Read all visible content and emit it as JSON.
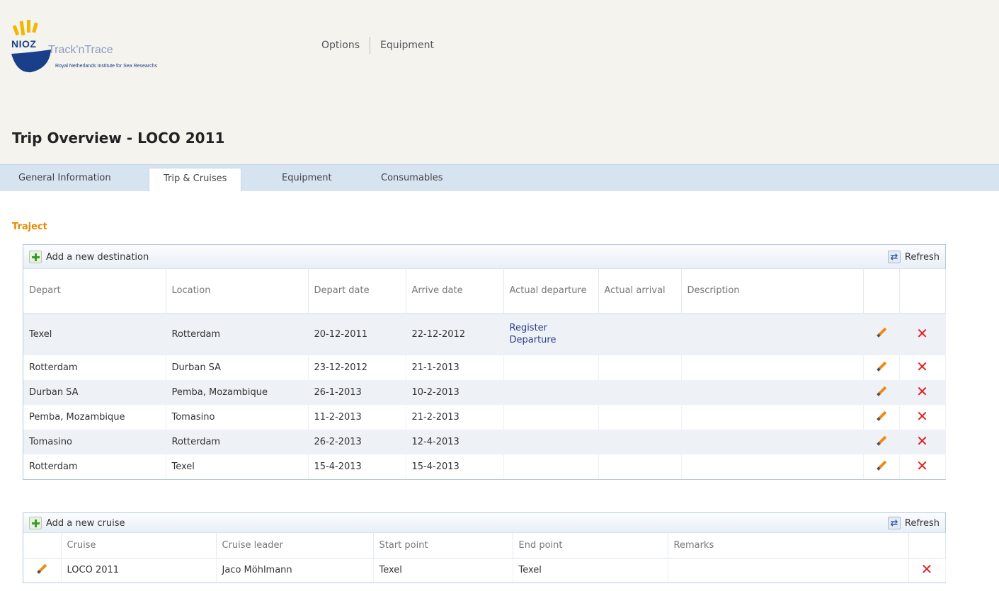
{
  "logo": {
    "brand": "NIOZ",
    "app_name": "Track'nTrace",
    "subtitle": "Royal Netherlands Institute for Sea Researchs"
  },
  "topnav": {
    "items": [
      "Options",
      "Equipment"
    ]
  },
  "page": {
    "title": "Trip Overview - LOCO 2011"
  },
  "tabs": [
    {
      "label": "General Information",
      "active": false
    },
    {
      "label": "Trip & Cruises",
      "active": true
    },
    {
      "label": "Equipment",
      "active": false
    },
    {
      "label": "Consumables",
      "active": false
    }
  ],
  "traject": {
    "section_title": "Traject",
    "add_label": "Add a new destination",
    "refresh_label": "Refresh",
    "columns": [
      "Depart",
      "Location",
      "Depart date",
      "Arrive date",
      "Actual departure",
      "Actual arrival",
      "Description"
    ],
    "rows": [
      {
        "depart": "Texel",
        "location": "Rotterdam",
        "depart_date": "20-12-2011",
        "arrive_date": "22-12-2012",
        "actual_departure": "Register Departure",
        "actual_arrival": "",
        "description": ""
      },
      {
        "depart": "Rotterdam",
        "location": "Durban SA",
        "depart_date": "23-12-2012",
        "arrive_date": "21-1-2013",
        "actual_departure": "",
        "actual_arrival": "",
        "description": ""
      },
      {
        "depart": "Durban SA",
        "location": "Pemba, Mozambique",
        "depart_date": "26-1-2013",
        "arrive_date": "10-2-2013",
        "actual_departure": "",
        "actual_arrival": "",
        "description": ""
      },
      {
        "depart": "Pemba, Mozambique",
        "location": "Tomasino",
        "depart_date": "11-2-2013",
        "arrive_date": "21-2-2013",
        "actual_departure": "",
        "actual_arrival": "",
        "description": ""
      },
      {
        "depart": "Tomasino",
        "location": "Rotterdam",
        "depart_date": "26-2-2013",
        "arrive_date": "12-4-2013",
        "actual_departure": "",
        "actual_arrival": "",
        "description": ""
      },
      {
        "depart": "Rotterdam",
        "location": "Texel",
        "depart_date": "15-4-2013",
        "arrive_date": "15-4-2013",
        "actual_departure": "",
        "actual_arrival": "",
        "description": ""
      }
    ]
  },
  "cruises": {
    "add_label": "Add a new cruise",
    "refresh_label": "Refresh",
    "columns": [
      "Cruise",
      "Cruise leader",
      "Start point",
      "End point",
      "Remarks"
    ],
    "rows": [
      {
        "cruise": "LOCO 2011",
        "leader": "Jaco Möhlmann",
        "start": "Texel",
        "end": "Texel",
        "remarks": ""
      }
    ]
  },
  "colors": {
    "accent": "#e88a00",
    "tab_bar": "#d6e3f0",
    "header_bg": "#f4f3ee",
    "delete": "#e02020",
    "edit": "#f08a10"
  },
  "icons": [
    "nioz-logo",
    "plus-icon",
    "refresh-icon",
    "pencil-icon",
    "delete-icon"
  ]
}
